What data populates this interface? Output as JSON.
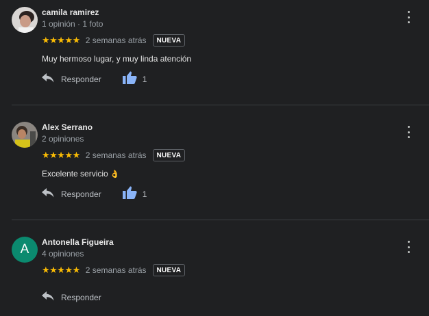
{
  "colors": {
    "star": "#fbbc04",
    "like": "#8ab4f8",
    "avatar_letter_bg": "#0b8a6f"
  },
  "reviews": [
    {
      "name": "camila ramirez",
      "meta": "1 opinión · 1 foto",
      "stars": "★★★★★",
      "date": "2 semanas atrás",
      "badge": "NUEVA",
      "text": "Muy hermoso lugar, y muy linda atención",
      "reply_label": "Responder",
      "likes": "1"
    },
    {
      "name": "Alex Serrano",
      "meta": "2 opiniones",
      "stars": "★★★★★",
      "date": "2 semanas atrás",
      "badge": "NUEVA",
      "text": "Excelente servicio",
      "emoji": "👌",
      "reply_label": "Responder",
      "likes": "1"
    },
    {
      "name": "Antonella Figueira",
      "avatar_letter": "A",
      "meta": "4 opiniones",
      "stars": "★★★★★",
      "date": "2 semanas atrás",
      "badge": "NUEVA",
      "reply_label": "Responder"
    }
  ]
}
